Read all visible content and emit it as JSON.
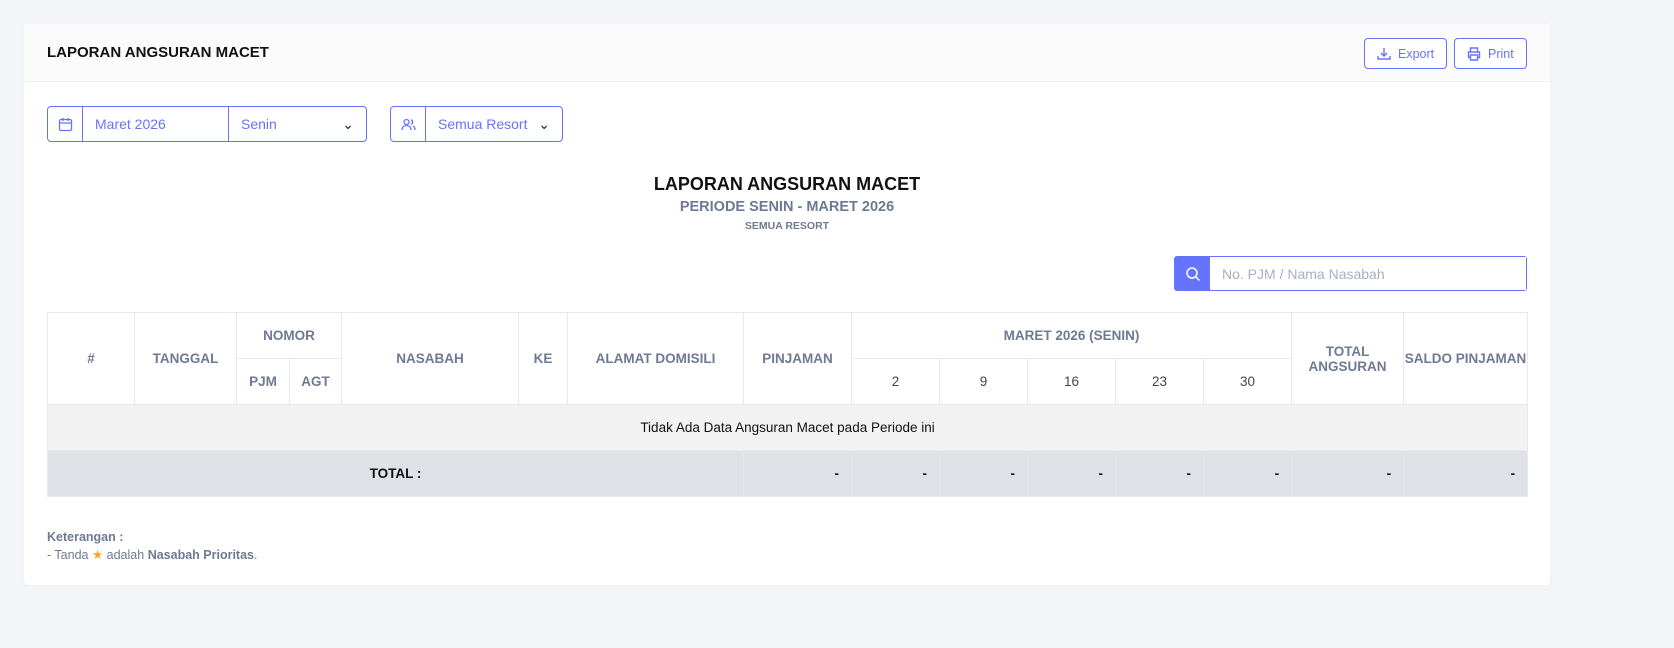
{
  "header": {
    "title": "LAPORAN ANGSURAN MACET",
    "export_label": "Export",
    "print_label": "Print"
  },
  "filters": {
    "month": "Maret 2026",
    "day": "Senin",
    "resort": "Semua Resort"
  },
  "report": {
    "title": "LAPORAN ANGSURAN MACET",
    "period": "PERIODE SENIN - MARET 2026",
    "resort": "SEMUA RESORT"
  },
  "search": {
    "placeholder": "No. PJM / Nama Nasabah"
  },
  "table": {
    "h": {
      "no": "#",
      "tanggal": "TANGGAL",
      "nomor": "NOMOR",
      "pjm": "PJM",
      "agt": "AGT",
      "nasabah": "NASABAH",
      "ke": "KE",
      "alamat": "ALAMAT DOMISILI",
      "pinjaman": "PINJAMAN",
      "period": "MARET 2026 (SENIN)",
      "total": "TOTAL ANGSURAN",
      "saldo": "SALDO PINJAMAN"
    },
    "dates": [
      "2",
      "9",
      "16",
      "23",
      "30"
    ],
    "empty": "Tidak Ada Data Angsuran Macet pada Periode ini",
    "total_label": "TOTAL :",
    "totals": [
      "-",
      "-",
      "-",
      "-",
      "-",
      "-",
      "-",
      "-"
    ]
  },
  "note": {
    "title": "Keterangan :",
    "prefix": "- Tanda",
    "middle": "adalah",
    "bold": "Nasabah Prioritas",
    "suffix": "."
  },
  "colors": {
    "accent": "#6673fd"
  }
}
